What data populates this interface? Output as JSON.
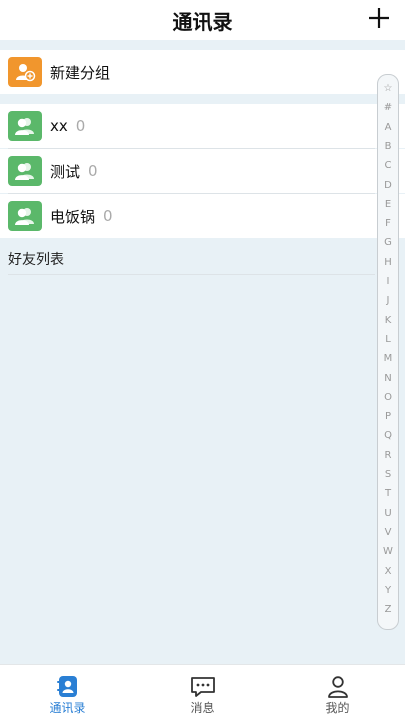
{
  "header": {
    "title": "通讯录"
  },
  "new_group": {
    "label": "新建分组"
  },
  "groups": [
    {
      "name": "xx",
      "count": "0"
    },
    {
      "name": "测试",
      "count": "0"
    },
    {
      "name": "电饭锅",
      "count": "0"
    }
  ],
  "friends_section": {
    "label": "好友列表"
  },
  "index_letters": [
    "☆",
    "#",
    "A",
    "B",
    "C",
    "D",
    "E",
    "F",
    "G",
    "H",
    "I",
    "J",
    "K",
    "L",
    "M",
    "N",
    "O",
    "P",
    "Q",
    "R",
    "S",
    "T",
    "U",
    "V",
    "W",
    "X",
    "Y",
    "Z"
  ],
  "tabbar": {
    "contacts": "通讯录",
    "messages": "消息",
    "mine": "我的"
  },
  "colors": {
    "accent": "#2a7fd4",
    "orange_avatar": "#f1962d",
    "green_avatar": "#5bb86a",
    "inactive_tab": "#555555"
  }
}
